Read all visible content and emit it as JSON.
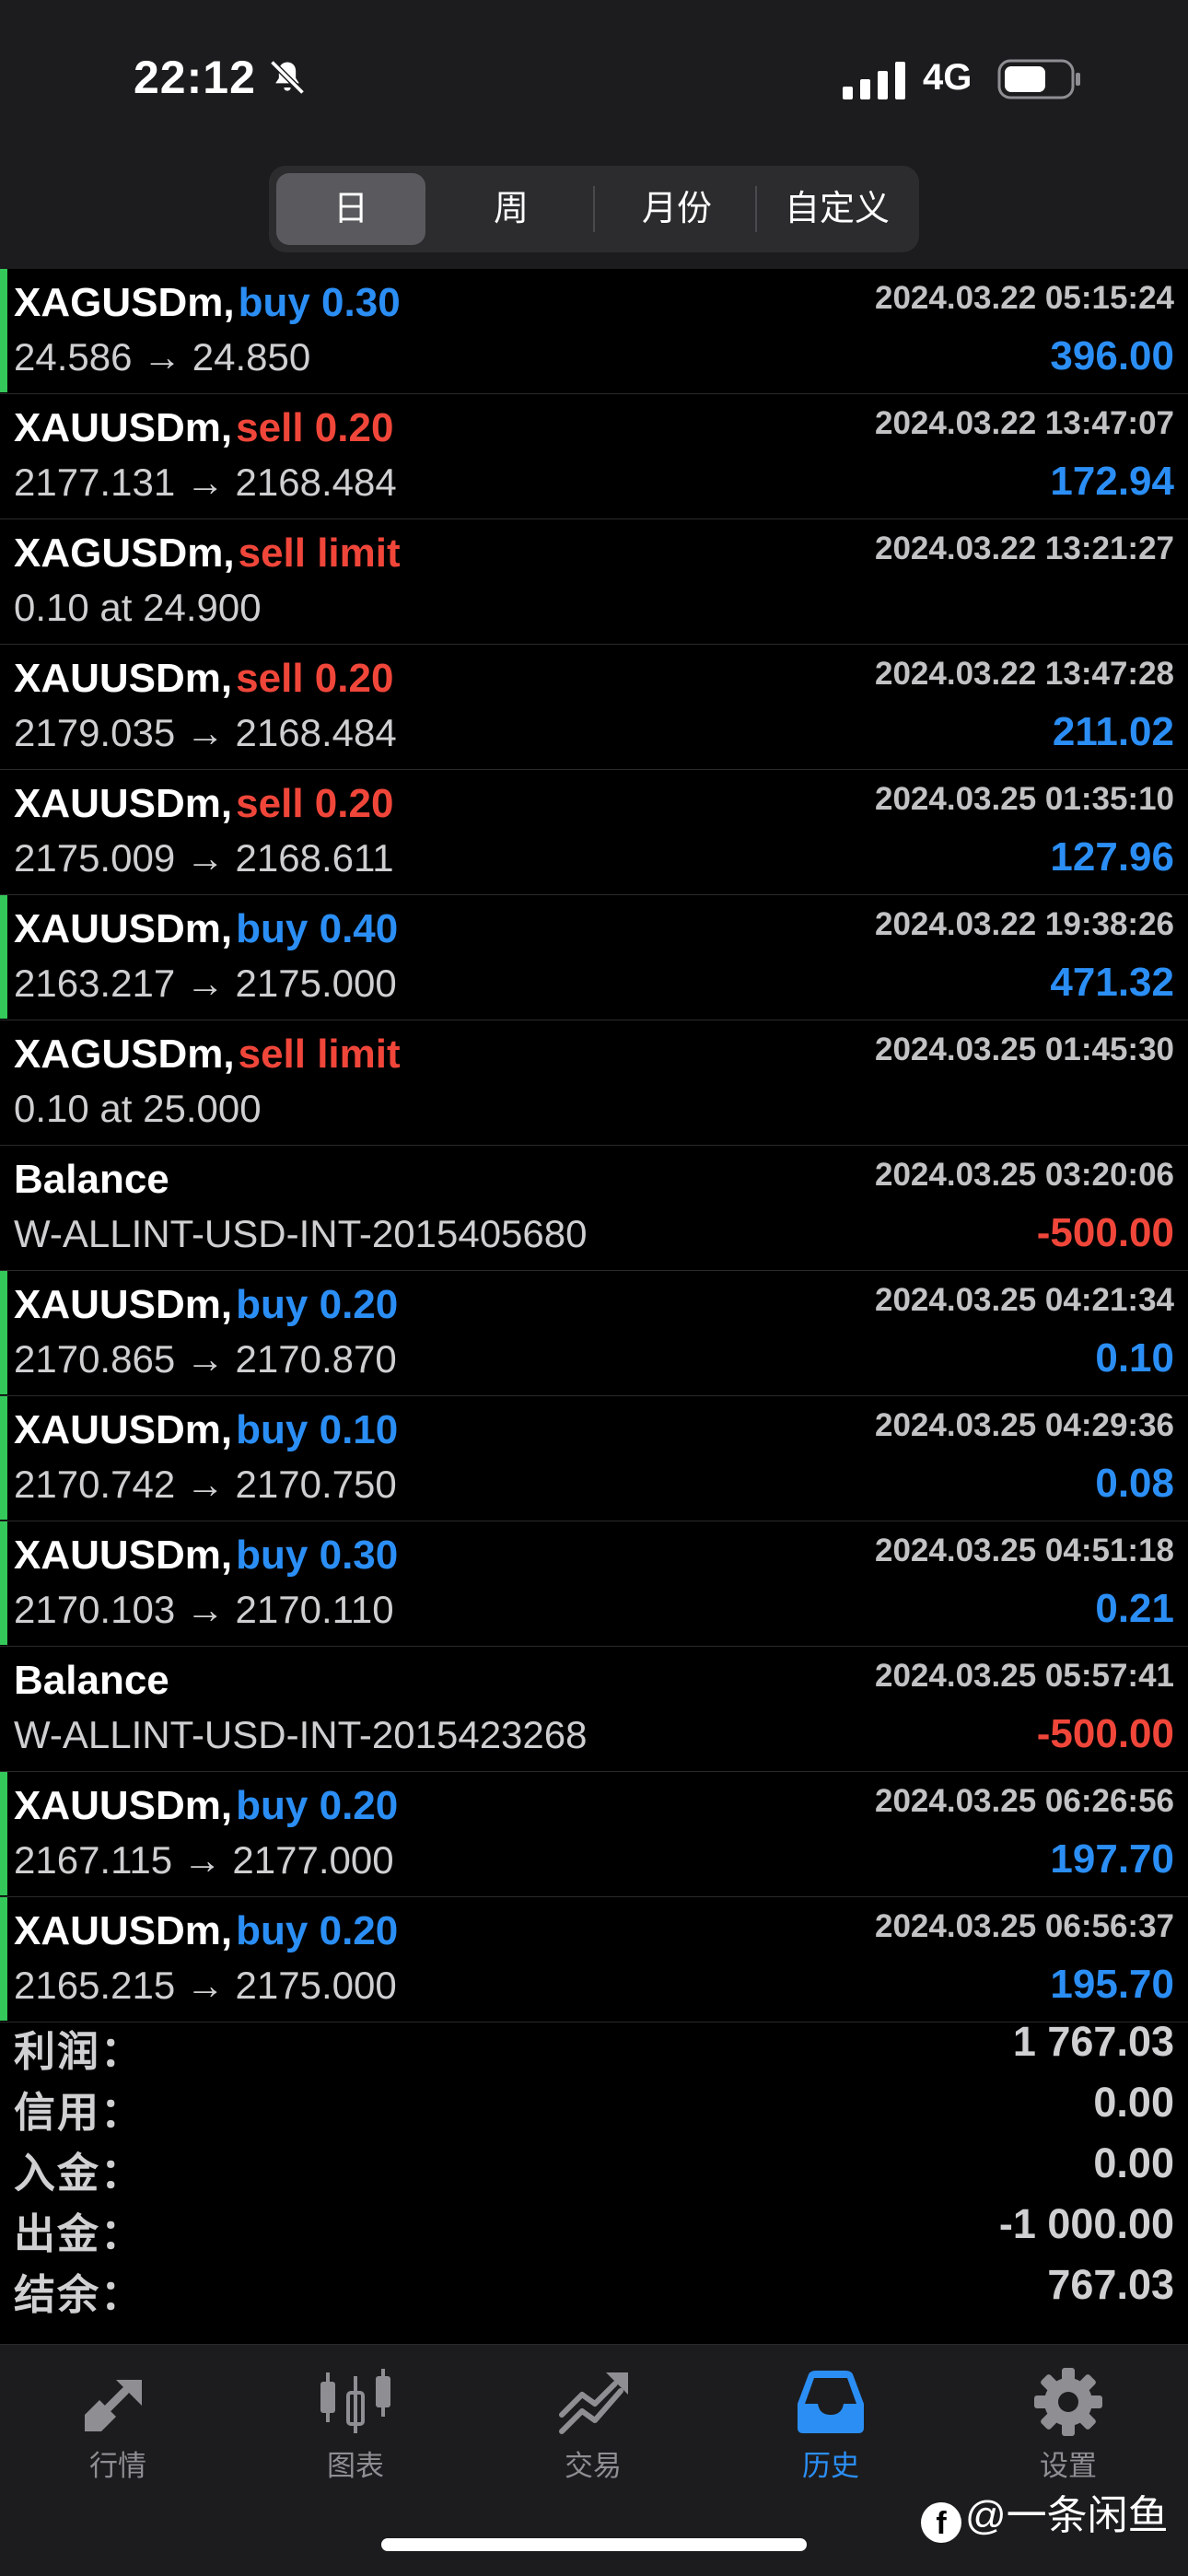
{
  "status_bar": {
    "time": "22:12",
    "network": "4G"
  },
  "tabs": [
    {
      "label": "日",
      "active": true
    },
    {
      "label": "周",
      "active": false
    },
    {
      "label": "月份",
      "active": false
    },
    {
      "label": "自定义",
      "active": false
    }
  ],
  "rows": [
    {
      "symbol": "XAGUSDm,",
      "action": "buy 0.30",
      "action_color": "blue",
      "time": "2024.03.22 05:15:24",
      "detail": "24.586 → 24.850",
      "profit": "396.00",
      "profit_color": "blue",
      "marker": true
    },
    {
      "symbol": "XAUUSDm,",
      "action": "sell 0.20",
      "action_color": "red",
      "time": "2024.03.22 13:47:07",
      "detail": "2177.131 → 2168.484",
      "profit": "172.94",
      "profit_color": "blue",
      "marker": false
    },
    {
      "symbol": "XAGUSDm,",
      "action": "sell limit",
      "action_color": "red",
      "time": "2024.03.22 13:21:27",
      "detail": "0.10 at 24.900",
      "profit": "",
      "profit_color": "blue",
      "marker": false
    },
    {
      "symbol": "XAUUSDm,",
      "action": "sell 0.20",
      "action_color": "red",
      "time": "2024.03.22 13:47:28",
      "detail": "2179.035 → 2168.484",
      "profit": "211.02",
      "profit_color": "blue",
      "marker": false
    },
    {
      "symbol": "XAUUSDm,",
      "action": "sell 0.20",
      "action_color": "red",
      "time": "2024.03.25 01:35:10",
      "detail": "2175.009 → 2168.611",
      "profit": "127.96",
      "profit_color": "blue",
      "marker": false
    },
    {
      "symbol": "XAUUSDm,",
      "action": "buy 0.40",
      "action_color": "blue",
      "time": "2024.03.22 19:38:26",
      "detail": "2163.217 → 2175.000",
      "profit": "471.32",
      "profit_color": "blue",
      "marker": true
    },
    {
      "symbol": "XAGUSDm,",
      "action": "sell limit",
      "action_color": "red",
      "time": "2024.03.25 01:45:30",
      "detail": "0.10 at 25.000",
      "profit": "",
      "profit_color": "blue",
      "marker": false
    },
    {
      "symbol": "Balance",
      "action": "",
      "action_color": "blue",
      "time": "2024.03.25 03:20:06",
      "detail": "W-ALLINT-USD-INT-2015405680",
      "profit": "-500.00",
      "profit_color": "red",
      "marker": false
    },
    {
      "symbol": "XAUUSDm,",
      "action": "buy 0.20",
      "action_color": "blue",
      "time": "2024.03.25 04:21:34",
      "detail": "2170.865 → 2170.870",
      "profit": "0.10",
      "profit_color": "blue",
      "marker": true
    },
    {
      "symbol": "XAUUSDm,",
      "action": "buy 0.10",
      "action_color": "blue",
      "time": "2024.03.25 04:29:36",
      "detail": "2170.742 → 2170.750",
      "profit": "0.08",
      "profit_color": "blue",
      "marker": true
    },
    {
      "symbol": "XAUUSDm,",
      "action": "buy 0.30",
      "action_color": "blue",
      "time": "2024.03.25 04:51:18",
      "detail": "2170.103 → 2170.110",
      "profit": "0.21",
      "profit_color": "blue",
      "marker": true
    },
    {
      "symbol": "Balance",
      "action": "",
      "action_color": "blue",
      "time": "2024.03.25 05:57:41",
      "detail": "W-ALLINT-USD-INT-2015423268",
      "profit": "-500.00",
      "profit_color": "red",
      "marker": false
    },
    {
      "symbol": "XAUUSDm,",
      "action": "buy 0.20",
      "action_color": "blue",
      "time": "2024.03.25 06:26:56",
      "detail": "2167.115 → 2177.000",
      "profit": "197.70",
      "profit_color": "blue",
      "marker": true
    },
    {
      "symbol": "XAUUSDm,",
      "action": "buy 0.20",
      "action_color": "blue",
      "time": "2024.03.25 06:56:37",
      "detail": "2165.215 → 2175.000",
      "profit": "195.70",
      "profit_color": "blue",
      "marker": true
    }
  ],
  "summary": [
    {
      "label": "利润：",
      "value": "1 767.03"
    },
    {
      "label": "信用：",
      "value": "0.00"
    },
    {
      "label": "入金：",
      "value": "0.00"
    },
    {
      "label": "出金：",
      "value": "-1 000.00"
    },
    {
      "label": "结余：",
      "value": "767.03"
    }
  ],
  "tabbar": [
    {
      "label": "行情",
      "icon": "quotes-arrows-icon",
      "active": false
    },
    {
      "label": "图表",
      "icon": "candlestick-chart-icon",
      "active": false
    },
    {
      "label": "交易",
      "icon": "trade-trend-icon",
      "active": false
    },
    {
      "label": "历史",
      "icon": "history-inbox-icon",
      "active": true
    },
    {
      "label": "设置",
      "icon": "gear-icon",
      "active": false
    }
  ],
  "watermark": "@一条闲鱼",
  "colors": {
    "blue": "#2b8ef5",
    "red": "#f0463a",
    "green_marker": "#34c759",
    "inactive_tab": "#8e8e93"
  }
}
